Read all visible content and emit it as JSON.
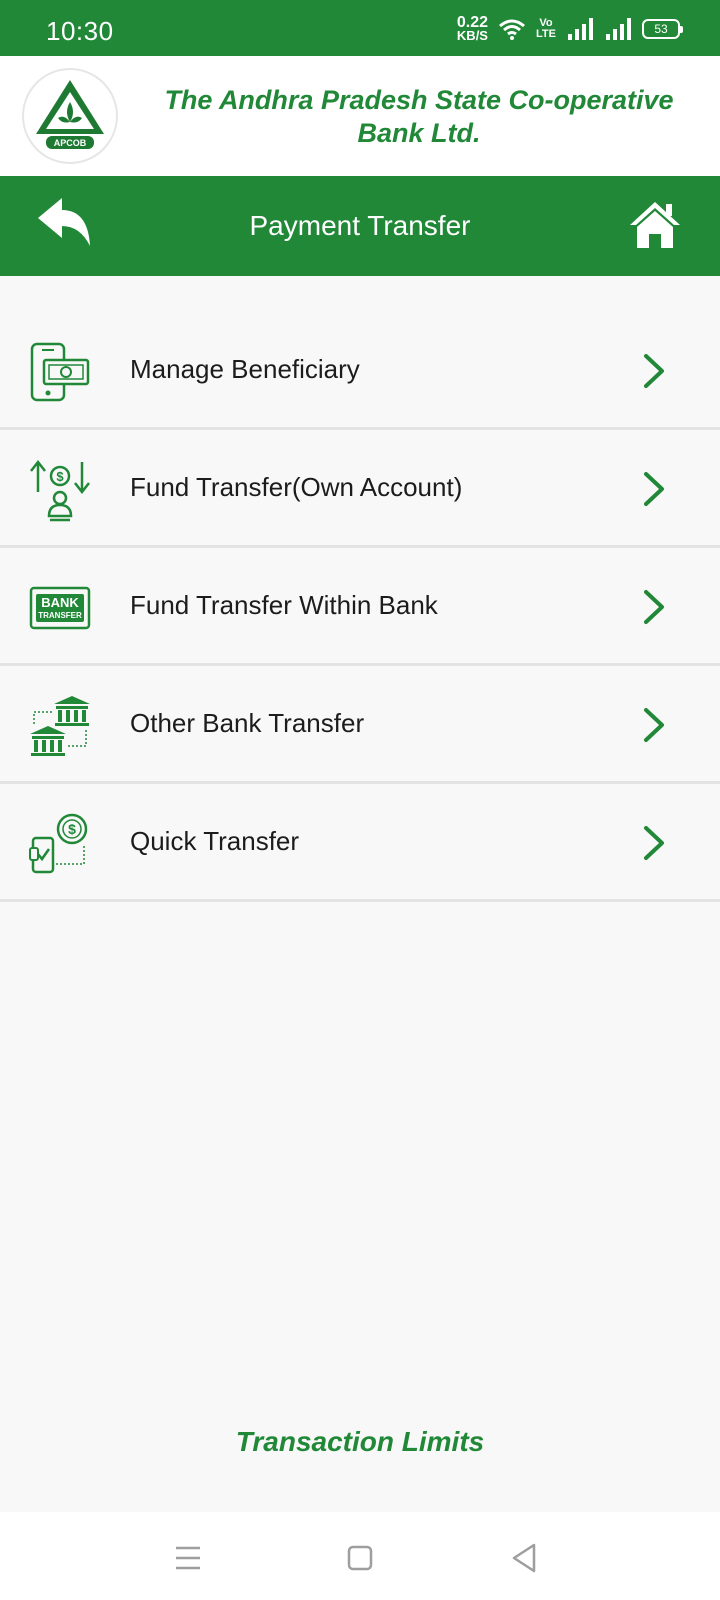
{
  "status_bar": {
    "time": "10:30",
    "net_speed_value": "0.22",
    "net_speed_unit": "KB/S",
    "volte_top": "Vo",
    "volte_bottom": "LTE",
    "battery": "53"
  },
  "header": {
    "logo_text": "APCOB",
    "bank_name": "The Andhra Pradesh State Co-operative Bank Ltd."
  },
  "navbar": {
    "title": "Payment Transfer",
    "back_icon": "back-arrow-icon",
    "home_icon": "home-icon"
  },
  "menu": {
    "items": [
      {
        "label": "Manage Beneficiary",
        "icon": "phone-cash-icon"
      },
      {
        "label": "Fund Transfer(Own Account)",
        "icon": "transfer-arrows-user-icon"
      },
      {
        "label": "Fund Transfer Within Bank",
        "icon": "bank-transfer-card-icon"
      },
      {
        "label": "Other Bank Transfer",
        "icon": "bank-to-bank-icon"
      },
      {
        "label": "Quick Transfer",
        "icon": "phone-dollar-icon"
      }
    ],
    "bank_card_top": "BANK",
    "bank_card_bottom": "TRANSFER"
  },
  "footer": {
    "limits_label": "Transaction Limits"
  },
  "colors": {
    "primary": "#218838",
    "background": "#f8f8f8"
  }
}
